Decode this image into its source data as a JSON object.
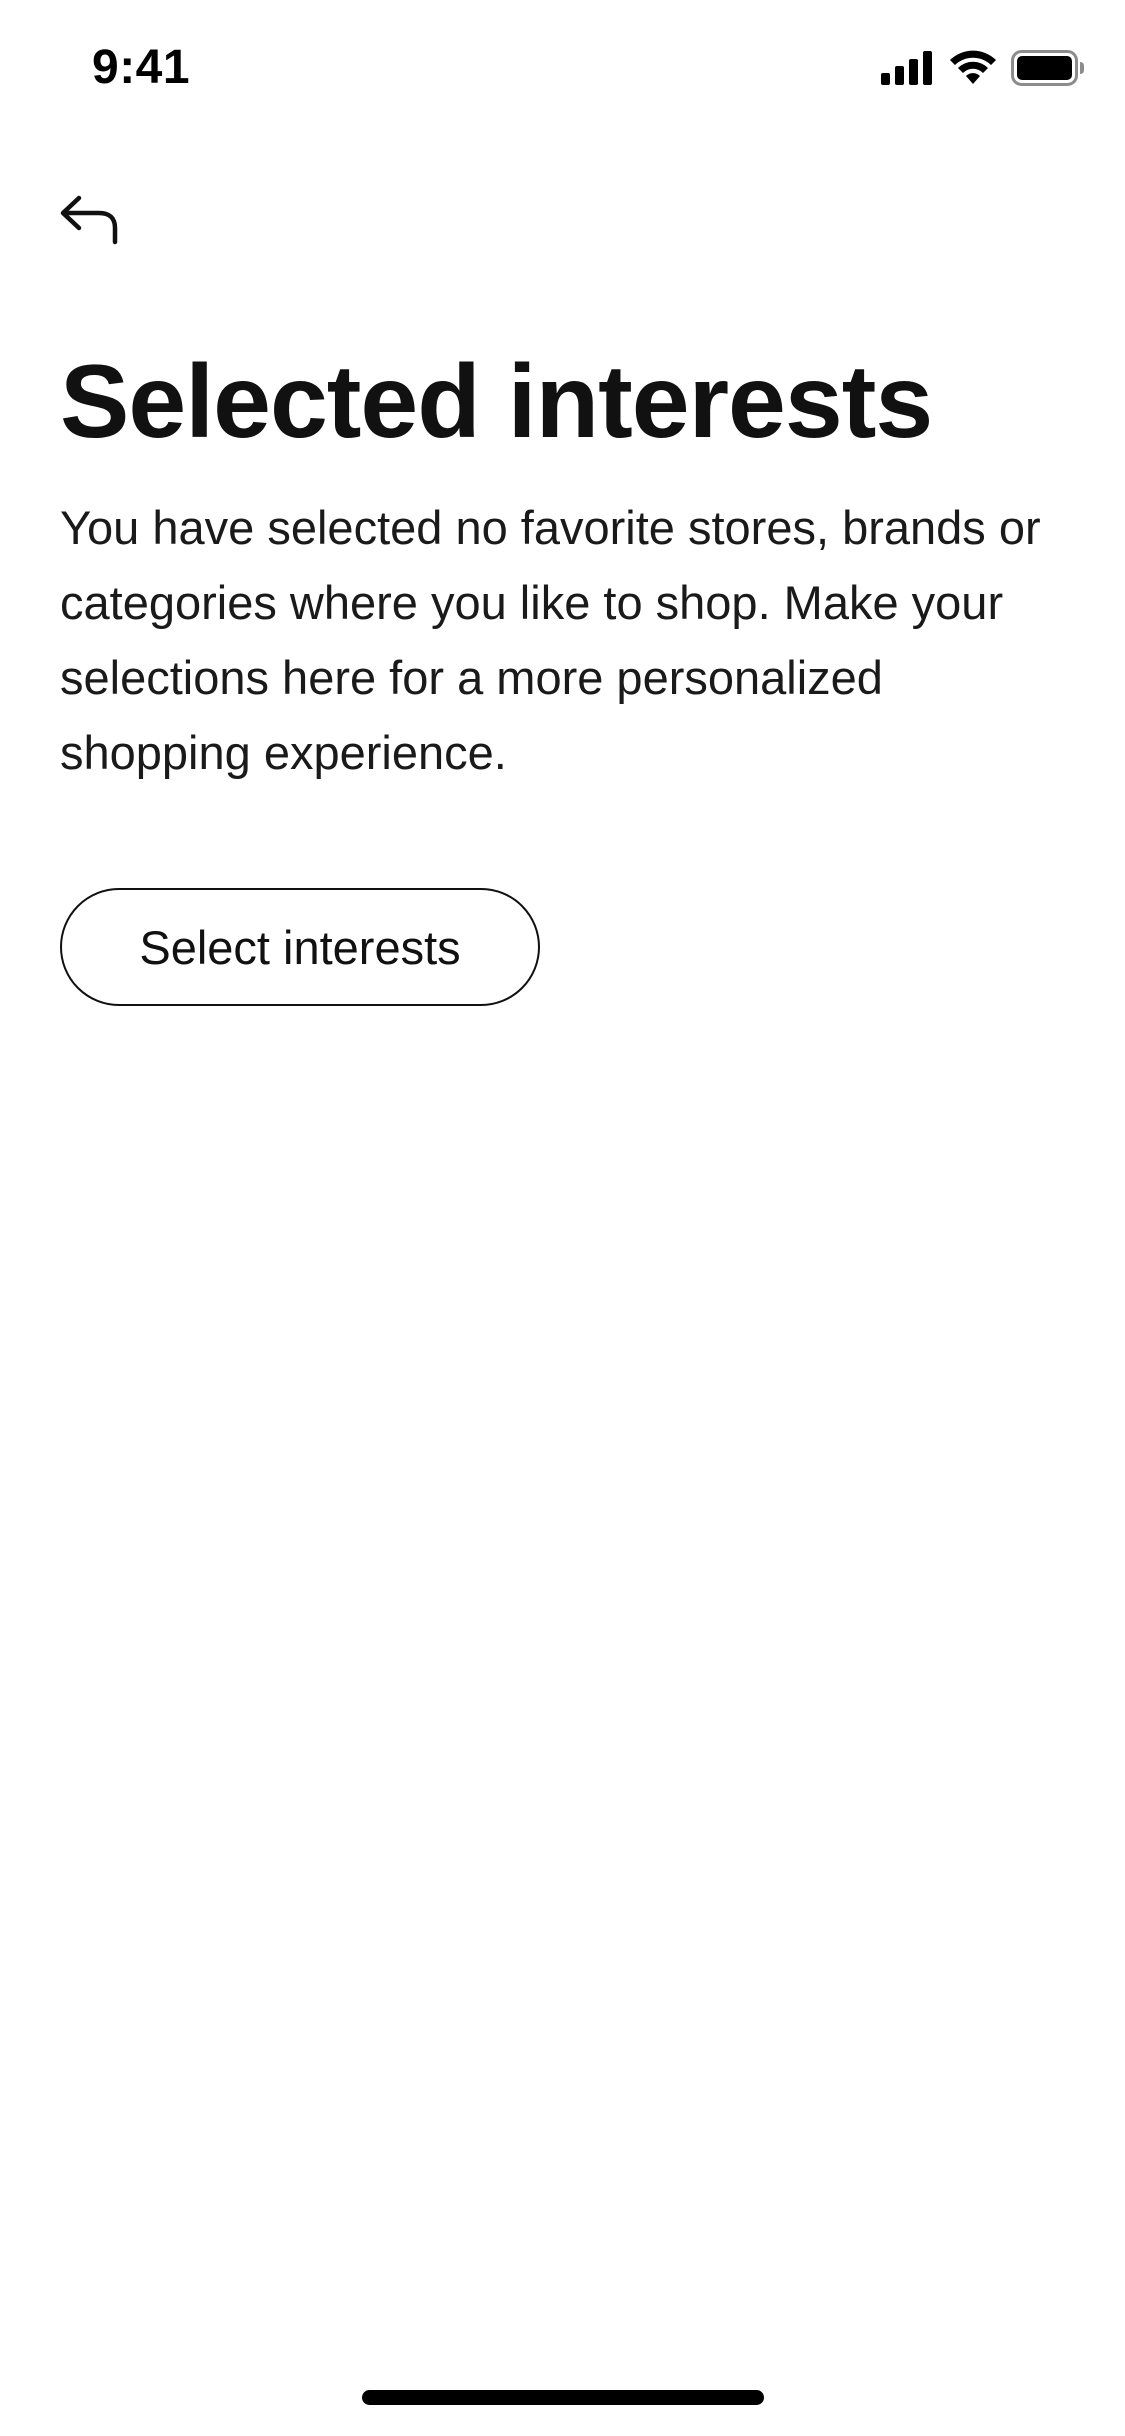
{
  "status_bar": {
    "time": "9:41",
    "icons": [
      "cellular-signal-icon",
      "wifi-icon",
      "battery-icon"
    ]
  },
  "navigation": {
    "back_icon": "back-arrow-icon"
  },
  "content": {
    "title": "Selected interests",
    "description": "You have selected no favorite stores, brands or categories where you like to shop. Make your selections here for a more personalized shopping experience.",
    "select_button_label": "Select interests"
  },
  "colors": {
    "text": "#111111",
    "background": "#ffffff",
    "button_border": "#111111"
  }
}
